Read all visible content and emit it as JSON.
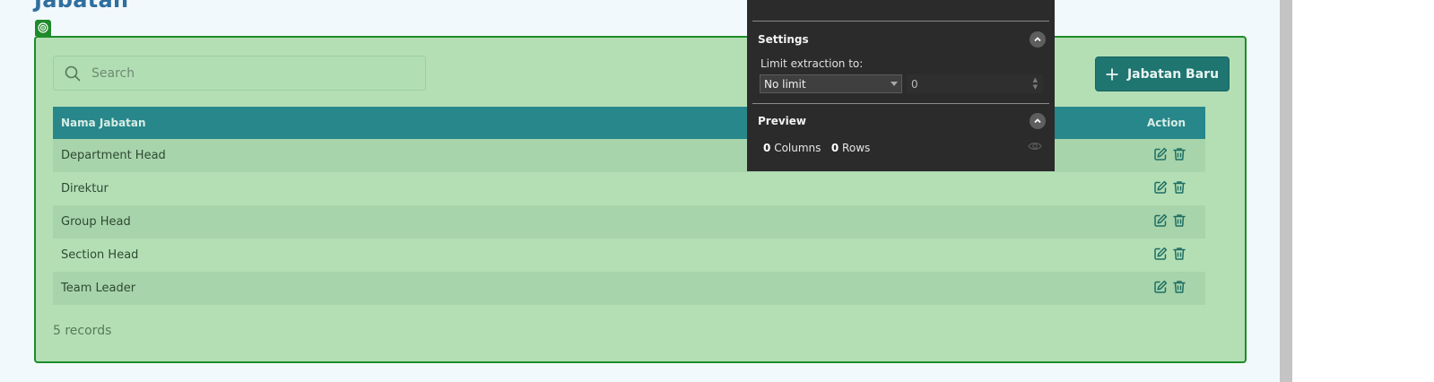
{
  "page": {
    "title": "Jabatan"
  },
  "search": {
    "placeholder": "Search"
  },
  "toolbar": {
    "add_label": "Jabatan Baru"
  },
  "table": {
    "headers": {
      "name": "Nama Jabatan",
      "action": "Action"
    },
    "rows": [
      {
        "name": "Department Head"
      },
      {
        "name": "Direktur"
      },
      {
        "name": "Group Head"
      },
      {
        "name": "Section Head"
      },
      {
        "name": "Team Leader"
      }
    ]
  },
  "footer": {
    "records": "5 records"
  },
  "overlay": {
    "settings_title": "Settings",
    "limit_label": "Limit extraction to:",
    "limit_value": "No limit",
    "limit_number": "0",
    "preview_title": "Preview",
    "columns_count": "0",
    "columns_label": "Columns",
    "rows_count": "0",
    "rows_label": "Rows"
  },
  "colors": {
    "accent": "#1f7570",
    "table_header": "#27878a",
    "highlight": "#b4dfb5",
    "highlight_border": "#1d8d29",
    "overlay_bg": "#2b2b2c"
  },
  "icons": [
    "target-icon",
    "search-icon",
    "plus-icon",
    "edit-icon",
    "trash-icon",
    "chevron-up-icon",
    "eye-icon"
  ]
}
